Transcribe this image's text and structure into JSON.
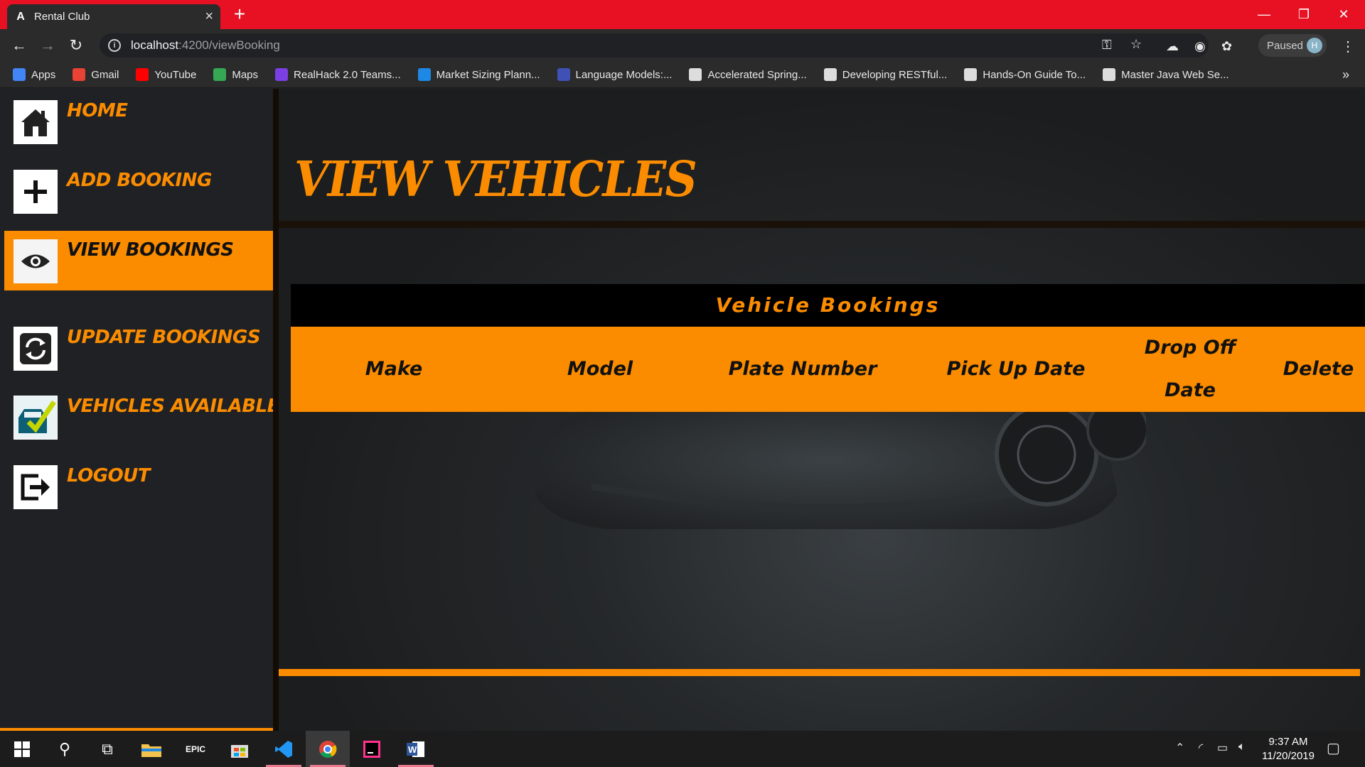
{
  "browser": {
    "tab_title": "Rental Club",
    "url_host": "localhost",
    "url_path": ":4200/viewBooking",
    "profile_status": "Paused",
    "profile_initial": "H"
  },
  "bookmarks": [
    {
      "label": "Apps",
      "color": "#4285f4"
    },
    {
      "label": "Gmail",
      "color": "#ea4335"
    },
    {
      "label": "YouTube",
      "color": "#ff0000"
    },
    {
      "label": "Maps",
      "color": "#34a853"
    },
    {
      "label": "RealHack 2.0 Teams...",
      "color": "#7b3fe4"
    },
    {
      "label": "Market Sizing Plann...",
      "color": "#1e88e5"
    },
    {
      "label": "Language Models:...",
      "color": "#3f51b5"
    },
    {
      "label": "Accelerated Spring...",
      "color": "#dddddd"
    },
    {
      "label": "Developing RESTful...",
      "color": "#dddddd"
    },
    {
      "label": "Hands-On Guide To...",
      "color": "#dddddd"
    },
    {
      "label": "Master Java Web Se...",
      "color": "#dddddd"
    }
  ],
  "sidebar": {
    "items": [
      {
        "label": "HOME",
        "icon": "home-icon"
      },
      {
        "label": "ADD BOOKING",
        "icon": "plus-icon"
      },
      {
        "label": "VIEW BOOKINGS",
        "icon": "eye-icon"
      },
      {
        "label": "UPDATE BOOKINGS",
        "icon": "refresh-icon"
      },
      {
        "label": "VEHICLES AVAILABLE",
        "icon": "vehicle-check-icon"
      },
      {
        "label": "LOGOUT",
        "icon": "logout-icon"
      }
    ],
    "active_index": 2
  },
  "main": {
    "title": "View Vehicles",
    "table": {
      "caption": "Vehicle Bookings",
      "headers": [
        "Make",
        "Model",
        "Plate Number",
        "Pick Up Date",
        "Drop Off Date",
        "Delete"
      ]
    }
  },
  "taskbar": {
    "time": "9:37 AM",
    "date": "11/20/2019"
  },
  "colors": {
    "accent": "#fb8c00",
    "chrome_frame": "#e81123"
  }
}
